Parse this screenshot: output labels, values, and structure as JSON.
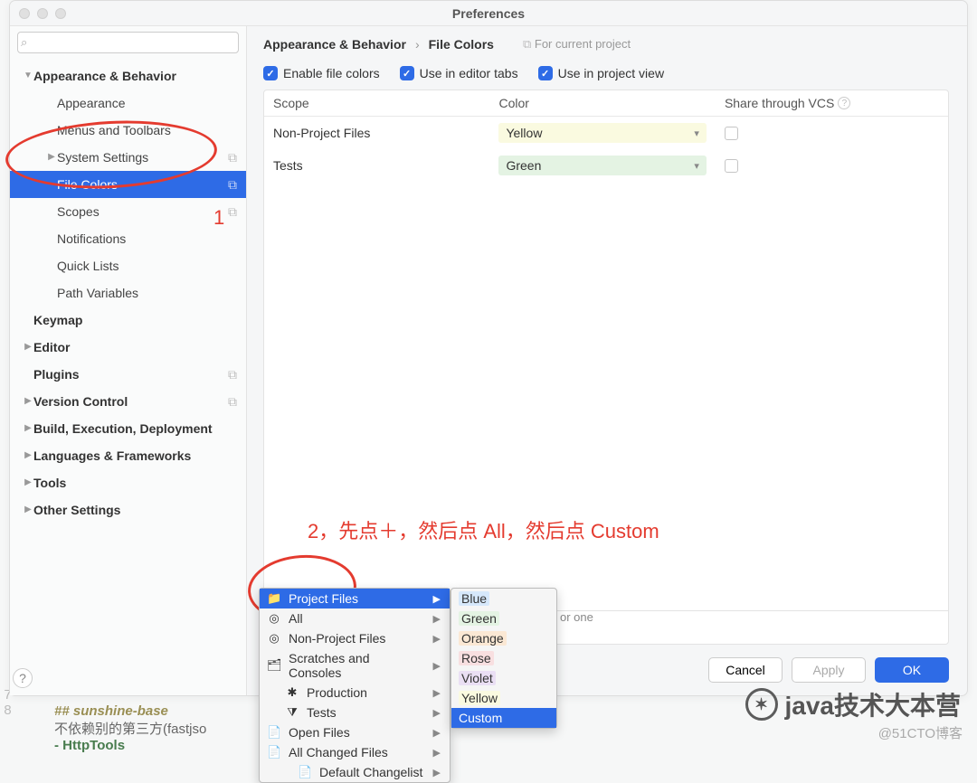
{
  "window": {
    "title": "Preferences"
  },
  "search": {
    "placeholder": ""
  },
  "sidebar": {
    "items": [
      {
        "label": "Appearance & Behavior",
        "bold": true,
        "arrow": "▼"
      },
      {
        "label": "Appearance",
        "child": true
      },
      {
        "label": "Menus and Toolbars",
        "child": true
      },
      {
        "label": "System Settings",
        "child": true,
        "arrow": "▶",
        "badge": true
      },
      {
        "label": "File Colors",
        "child": true,
        "selected": true,
        "badge": true
      },
      {
        "label": "Scopes",
        "child": true,
        "badge": true
      },
      {
        "label": "Notifications",
        "child": true
      },
      {
        "label": "Quick Lists",
        "child": true
      },
      {
        "label": "Path Variables",
        "child": true
      },
      {
        "label": "Keymap",
        "bold": true
      },
      {
        "label": "Editor",
        "bold": true,
        "arrow": "▶"
      },
      {
        "label": "Plugins",
        "bold": true,
        "badge": true
      },
      {
        "label": "Version Control",
        "bold": true,
        "arrow": "▶",
        "badge": true
      },
      {
        "label": "Build, Execution, Deployment",
        "bold": true,
        "arrow": "▶"
      },
      {
        "label": "Languages & Frameworks",
        "bold": true,
        "arrow": "▶"
      },
      {
        "label": "Tools",
        "bold": true,
        "arrow": "▶"
      },
      {
        "label": "Other Settings",
        "bold": true,
        "arrow": "▶"
      }
    ]
  },
  "breadcrumb": {
    "a": "Appearance & Behavior",
    "b": "File Colors",
    "tag": "For current project"
  },
  "checks": [
    {
      "label": "Enable file colors"
    },
    {
      "label": "Use in editor tabs"
    },
    {
      "label": "Use in project view"
    }
  ],
  "table": {
    "headers": {
      "scope": "Scope",
      "color": "Color",
      "share": "Share through VCS"
    },
    "rows": [
      {
        "scope": "Non-Project Files",
        "color": "Yellow",
        "cls": "yellow"
      },
      {
        "scope": "Tests",
        "color": "Green",
        "cls": "green"
      }
    ]
  },
  "hint_partial": "or one",
  "footer": {
    "cancel": "Cancel",
    "apply": "Apply",
    "ok": "OK"
  },
  "annotations": {
    "n1": "1",
    "n2": "2，先点＋，然后点 All，然后点 Custom"
  },
  "scope_menu": [
    {
      "icon": "📁",
      "label": "Project Files",
      "selected": true,
      "arrow": true
    },
    {
      "icon": "◎",
      "label": "All",
      "arrow": true
    },
    {
      "icon": "◎",
      "label": "Non-Project Files",
      "arrow": true
    },
    {
      "icon": "🗂",
      "label": "Scratches and Consoles",
      "arrow": true
    },
    {
      "icon": "✱",
      "label": "Production",
      "indent": true,
      "arrow": true
    },
    {
      "icon": "⧩",
      "label": "Tests",
      "indent": true,
      "arrow": true
    },
    {
      "icon": "📄",
      "label": "Open Files",
      "arrow": true
    },
    {
      "icon": "📄",
      "label": "All Changed Files",
      "arrow": true
    },
    {
      "icon": "📄",
      "label": "Default Changelist",
      "indent2": true,
      "arrow": true
    }
  ],
  "color_menu": [
    {
      "label": "Blue",
      "cls": "sw-blue"
    },
    {
      "label": "Green",
      "cls": "sw-green"
    },
    {
      "label": "Orange",
      "cls": "sw-orange"
    },
    {
      "label": "Rose",
      "cls": "sw-rose"
    },
    {
      "label": "Violet",
      "cls": "sw-violet"
    },
    {
      "label": "Yellow",
      "cls": "sw-yellow"
    },
    {
      "label": "Custom",
      "selected": true
    }
  ],
  "bg": {
    "l1": "## sunshine-base",
    "l2": "不依赖别的第三方(fastjso",
    "l3": "- HttpTools"
  },
  "watermark": "java技术大本营",
  "watermark_sub": "@51CTO博客",
  "linenum": "7\n8"
}
